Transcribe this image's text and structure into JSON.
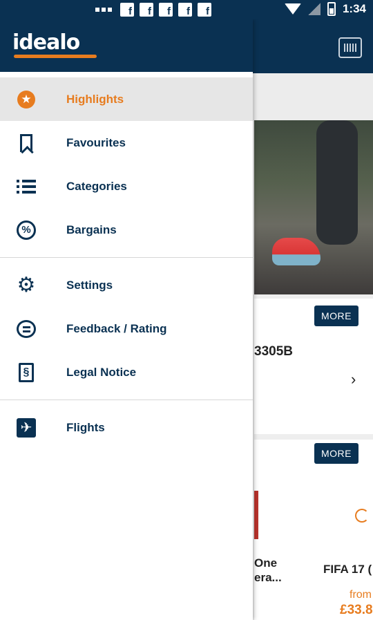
{
  "status_bar": {
    "time": "1:34",
    "notification_icons": [
      "facebook-icon",
      "facebook-icon",
      "facebook-icon",
      "facebook-icon",
      "facebook-icon"
    ]
  },
  "drawer": {
    "logo_text": "idealo",
    "groups": [
      {
        "items": [
          {
            "label": "Highlights",
            "icon": "star-badge-icon",
            "active": true
          },
          {
            "label": "Favourites",
            "icon": "bookmark-icon",
            "active": false
          },
          {
            "label": "Categories",
            "icon": "list-icon",
            "active": false
          },
          {
            "label": "Bargains",
            "icon": "percent-icon",
            "active": false
          }
        ]
      },
      {
        "items": [
          {
            "label": "Settings",
            "icon": "gear-icon",
            "active": false
          },
          {
            "label": "Feedback / Rating",
            "icon": "chat-bubble-icon",
            "active": false
          },
          {
            "label": "Legal Notice",
            "icon": "section-document-icon",
            "active": false
          }
        ]
      },
      {
        "items": [
          {
            "label": "Flights",
            "icon": "airplane-icon",
            "active": false
          }
        ]
      }
    ]
  },
  "background": {
    "more_label_1": "MORE",
    "more_label_2": "MORE",
    "product_code": "3305B",
    "product_text_one": "One",
    "product_text_one_line2": "era...",
    "product_text_fifa": "FIFA 17 (",
    "price_prefix": "from",
    "price_value": "£33.8"
  },
  "colors": {
    "brand_navy": "#0a3152",
    "accent_orange": "#e77c1f",
    "active_row_bg": "#e6e6e6"
  }
}
